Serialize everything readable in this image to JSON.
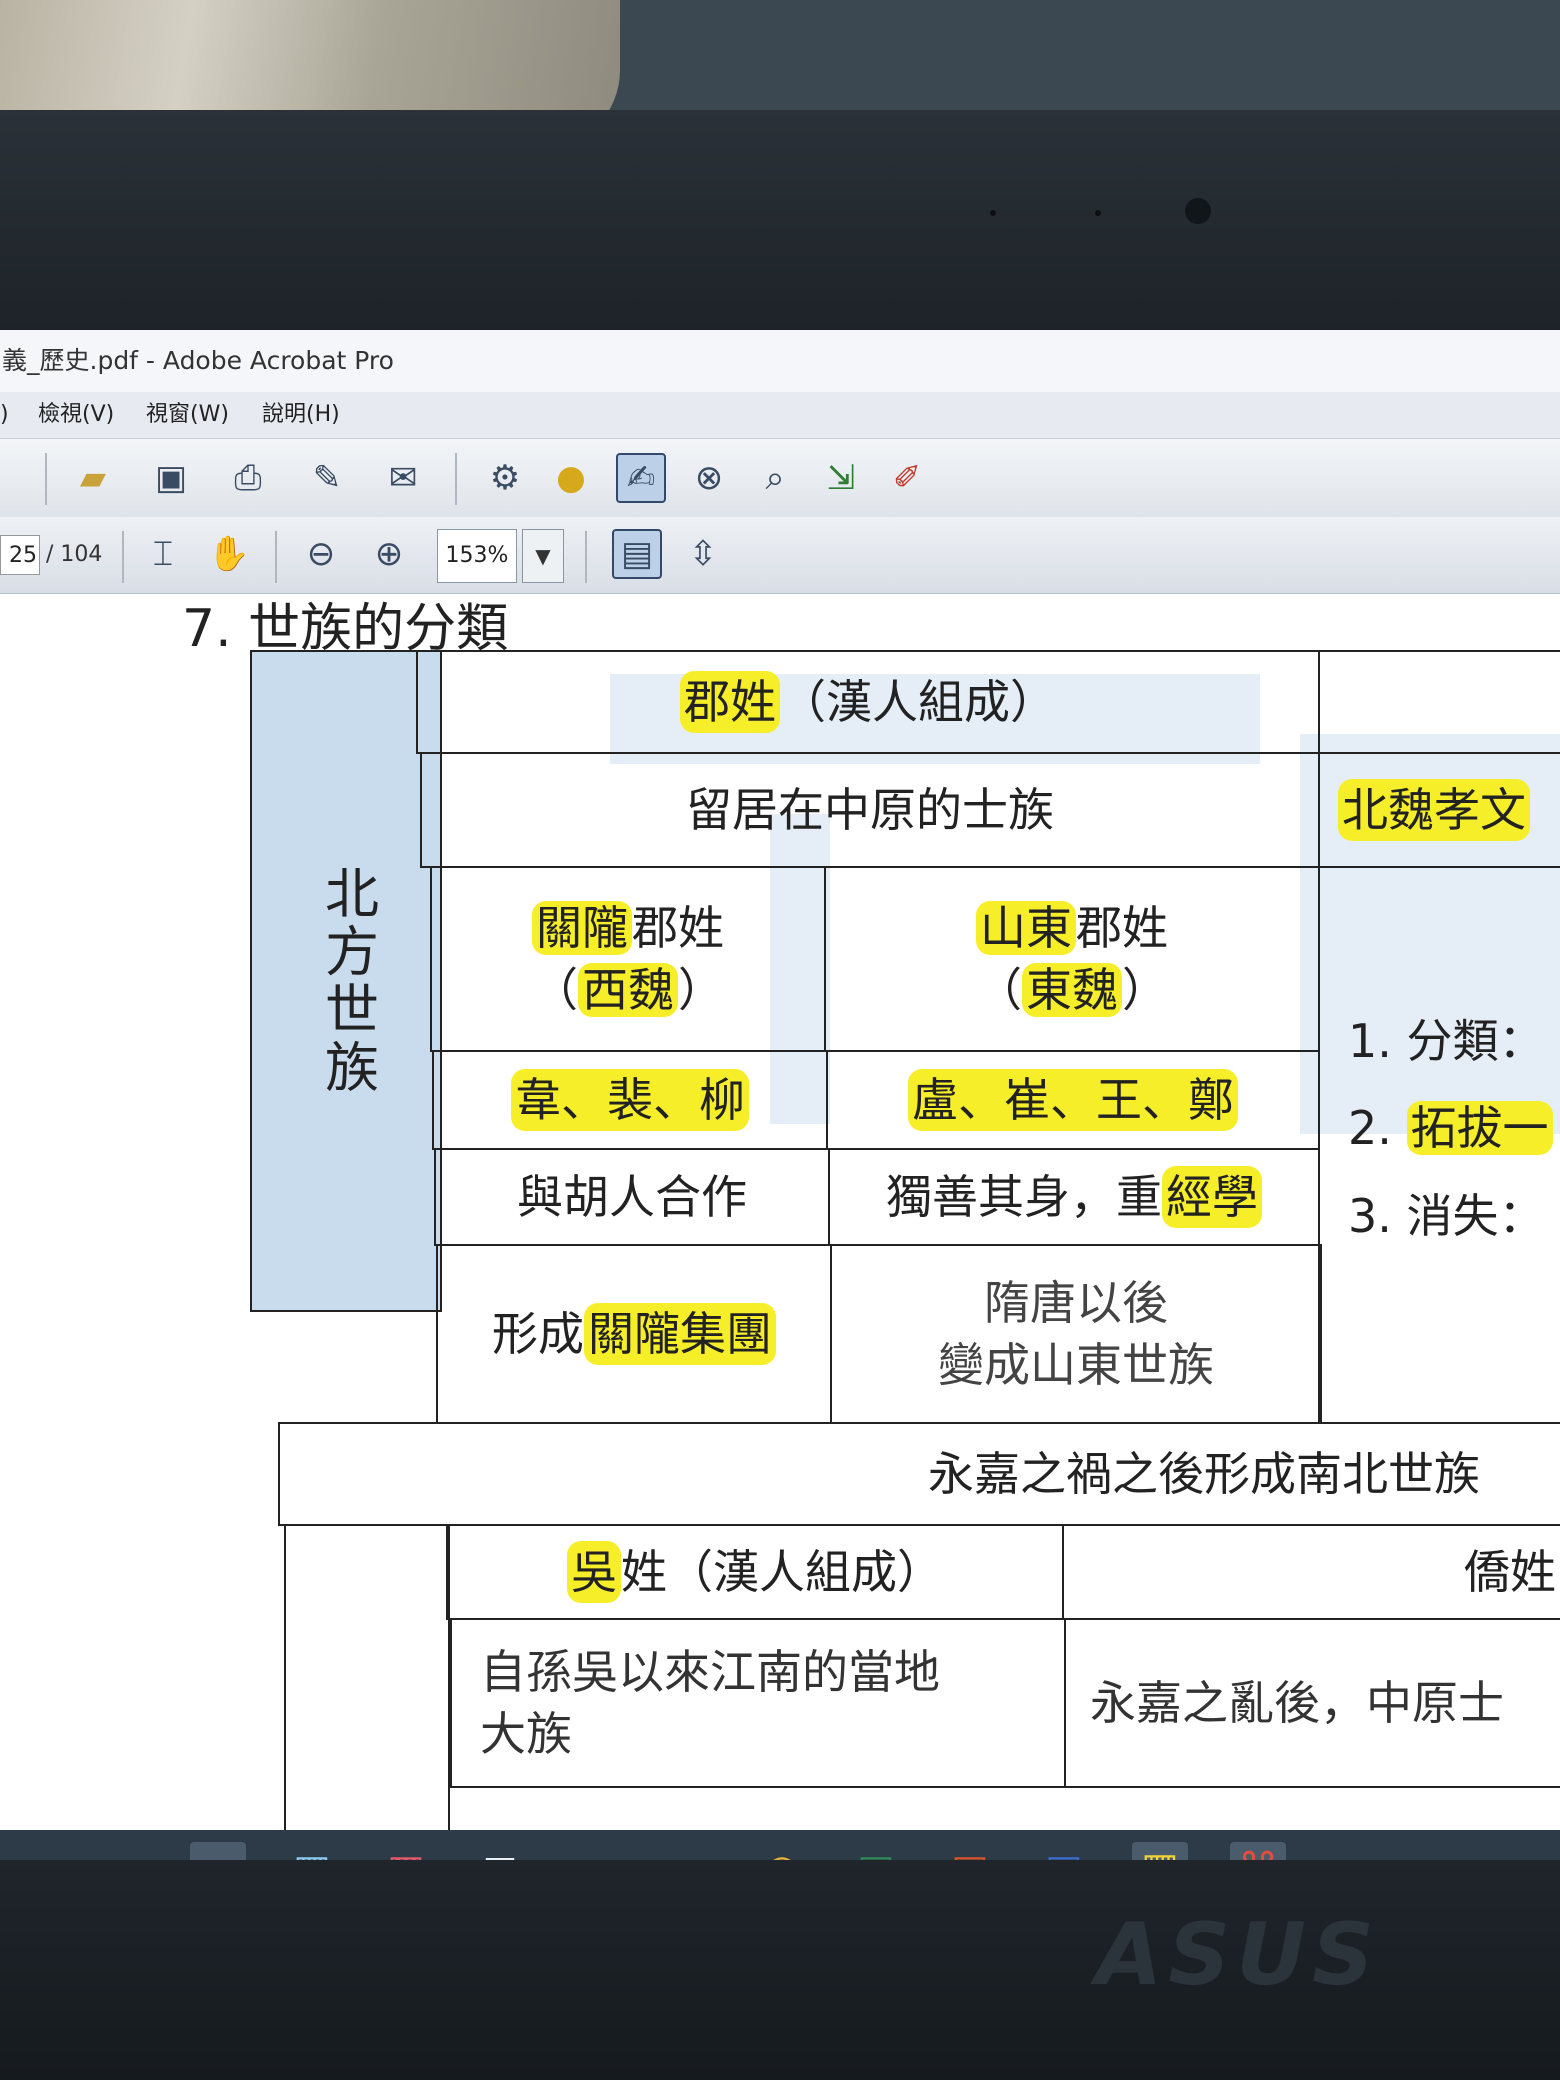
{
  "window": {
    "title": "義_歷史.pdf - Adobe Acrobat Pro"
  },
  "menu": {
    "items": [
      ")",
      "檢視(V)",
      "視窗(W)",
      "說明(H)"
    ]
  },
  "nav": {
    "page_current": "25",
    "page_total": "/ 104",
    "zoom": "153%"
  },
  "document": {
    "section_title": "7. 世族的分類",
    "north": {
      "side_label": "北方世族",
      "jun_xing": {
        "highlight": "郡姓",
        "rest": "（漢人組成）"
      },
      "stay_row": "留居在中原的士族",
      "guanlong": {
        "name_hl": "關隴",
        "name_rest": "郡姓",
        "sub_open": "（",
        "sub_hl": "西魏",
        "sub_close": "）"
      },
      "shandong": {
        "name_hl": "山東",
        "name_rest": "郡姓",
        "sub_open": "（",
        "sub_hl": "東魏",
        "sub_close": "）"
      },
      "guanlong_families": "韋、裴、柳",
      "shandong_families": "盧、崔、王、鄭",
      "guanlong_policy": "與胡人合作",
      "shandong_policy_rest": "獨善其身，重",
      "shandong_policy_hl": "經學",
      "guanlong_result_rest": "形成",
      "guanlong_result_hl": "關隴集團",
      "shandong_result_line1": "隋唐以後",
      "shandong_result_line2": "變成山東世族",
      "right_top": "北魏孝文",
      "right_list": [
        {
          "num": "1.",
          "text": "分類：",
          "hl": false
        },
        {
          "num": "2.",
          "text": "拓拔一",
          "hl": true
        },
        {
          "num": "3.",
          "text": "消失：",
          "hl": false
        }
      ]
    },
    "divider_text": "永嘉之禍之後形成南北世族",
    "south": {
      "wu_xing": {
        "highlight": "吳",
        "rest": "姓（漢人組成）"
      },
      "wu_desc_line1": "自孫吳以來江南的當地",
      "wu_desc_line2": "大族",
      "qiao_xing": "僑姓",
      "qiao_desc": "永嘉之亂後，中原士"
    }
  },
  "icons": {
    "toolbar": [
      "open-folder-icon",
      "save-icon",
      "print-icon",
      "edit-icon",
      "email-icon",
      "gear-icon",
      "comment-icon",
      "typewriter-icon",
      "delete-page-icon",
      "search-page-icon",
      "export-page-icon",
      "sign-icon"
    ],
    "taskbar": [
      "search-icon",
      "task-view-icon",
      "file-explorer-icon",
      "store-icon",
      "gift-icon",
      "mail-icon",
      "edge-icon",
      "ie-icon",
      "chrome-icon",
      "excel-icon",
      "powerpoint-icon",
      "word-icon",
      "app-grid-icon",
      "acrobat-icon"
    ]
  },
  "colors": {
    "highlight": "#f7ee2a",
    "side_column": "#c9dcee",
    "taskbar": "#2d3a47"
  }
}
